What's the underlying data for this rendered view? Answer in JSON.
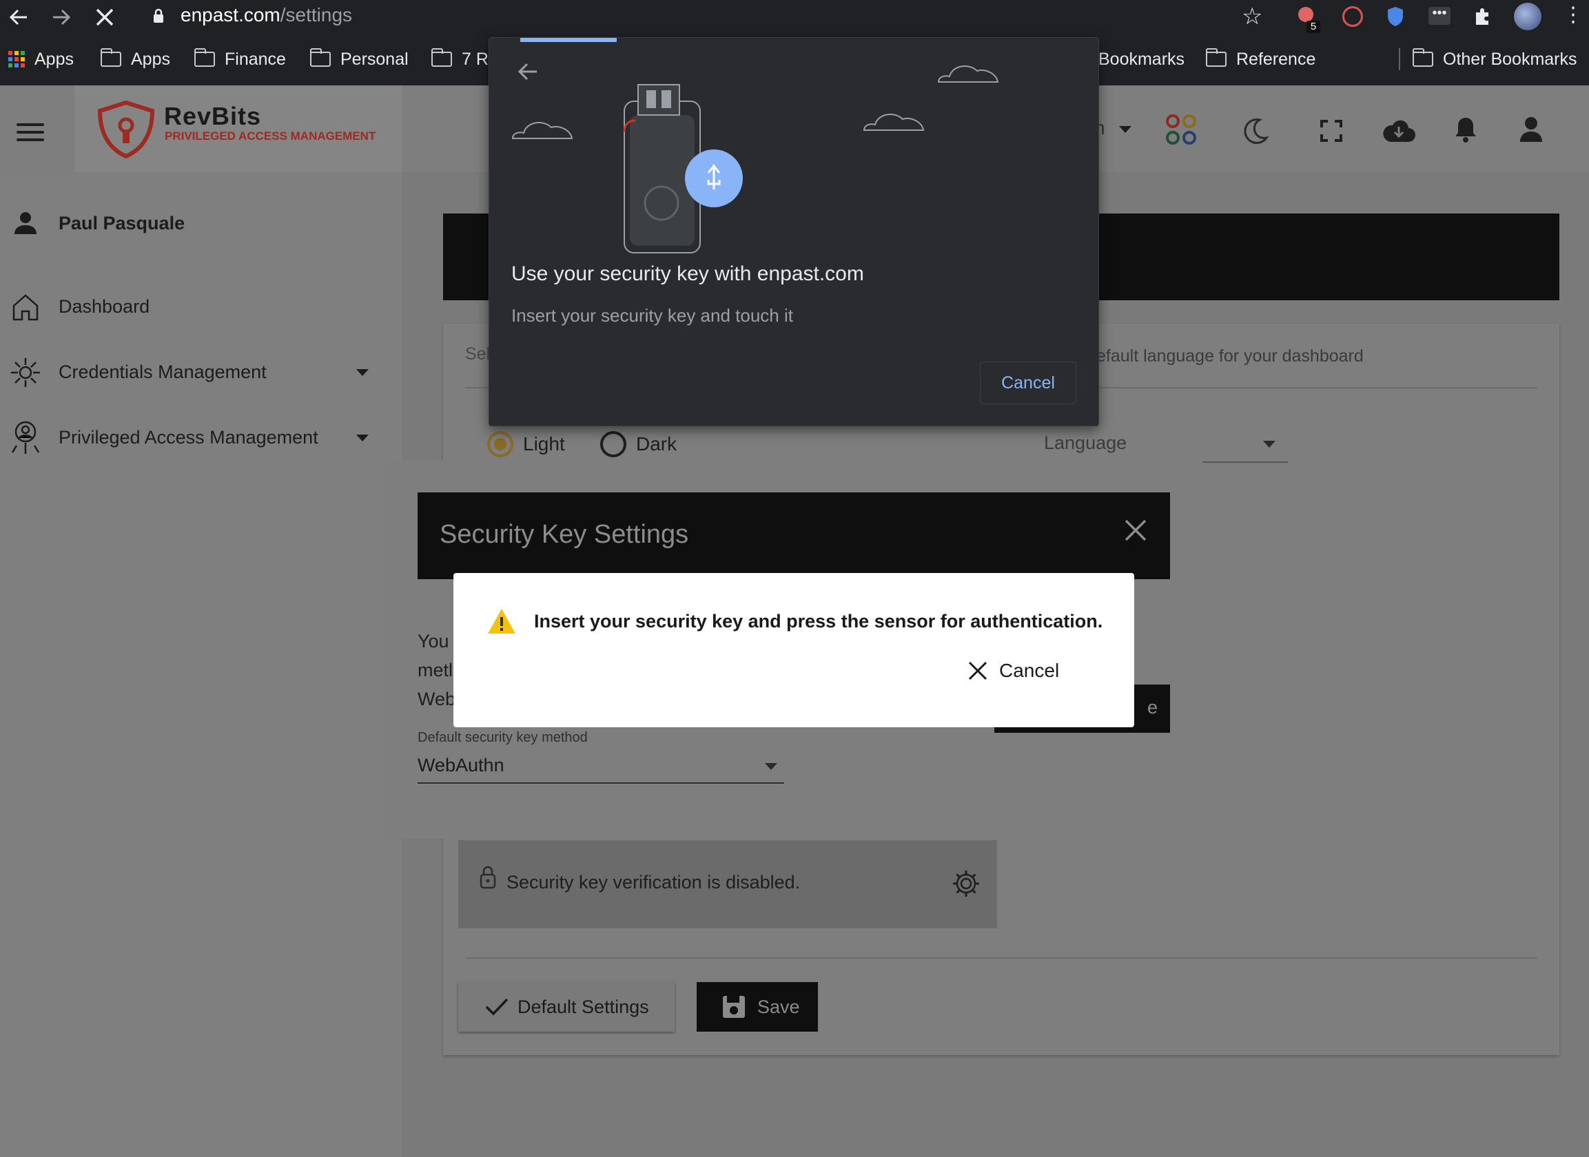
{
  "browser": {
    "url_host": "enpast.com",
    "url_path": "/settings",
    "extension_badge": "5",
    "bookmarks": [
      "Apps",
      "Apps",
      "Finance",
      "Personal",
      "7 R",
      "Bookmarks",
      "Reference",
      "Other Bookmarks"
    ]
  },
  "app": {
    "brand_name": "RevBits",
    "brand_tagline": "PRIVILEGED ACCESS MANAGEMENT",
    "header_partial_text": "n"
  },
  "sidebar": {
    "user_name": "Paul Pasquale",
    "items": [
      {
        "label": "Dashboard"
      },
      {
        "label": "Credentials Management"
      },
      {
        "label": "Privileged Access Management"
      }
    ]
  },
  "settings": {
    "banner_partial": "Se",
    "select_partial": "Sel",
    "language_hint_partial": "efault language for your dashboard",
    "theme_options": [
      "Light",
      "Dark"
    ],
    "theme_selected": "Light",
    "language_label": "Language",
    "security_status": "Security key verification is disabled.",
    "default_settings_label": "Default Settings",
    "save_label": "Save"
  },
  "security_key_dialog": {
    "title": "Security Key Settings",
    "body_partial": [
      "You",
      "metl",
      "Web"
    ],
    "button_partial": "e",
    "method_label": "Default security key method",
    "method_value": "WebAuthn"
  },
  "alert": {
    "message": "Insert your security key and press the sensor for authentication.",
    "cancel_label": "Cancel"
  },
  "webauthn_prompt": {
    "title": "Use your security key with enpast.com",
    "subtitle": "Insert your security key and touch it",
    "cancel_label": "Cancel"
  },
  "colors": {
    "brand_red": "#c0392b",
    "chrome_bg": "#202124",
    "webauthn_bg": "#2a2b2f",
    "webauthn_accent": "#8ab4f8",
    "warning_yellow": "#f4c20d"
  }
}
